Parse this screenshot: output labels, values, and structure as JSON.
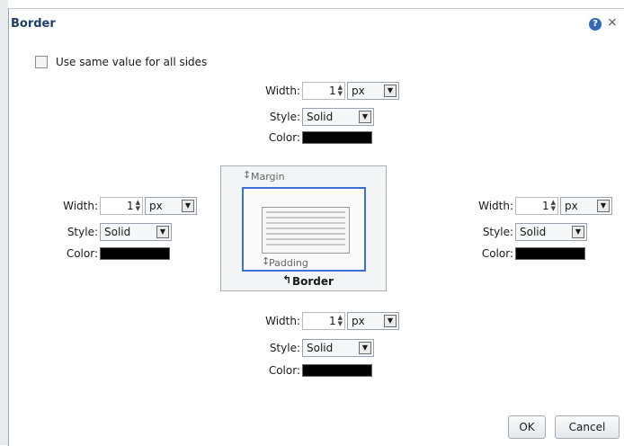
{
  "dialog": {
    "title": "Border",
    "help_icon": "?",
    "close_icon": "×"
  },
  "same_value": {
    "label": "Use same value for all sides",
    "checked": false
  },
  "labels": {
    "width": "Width:",
    "style": "Style:",
    "color": "Color:"
  },
  "top": {
    "width": "1",
    "unit": "px",
    "style": "Solid",
    "color": "#000000"
  },
  "left": {
    "width": "1",
    "unit": "px",
    "style": "Solid",
    "color": "#000000"
  },
  "right": {
    "width": "1",
    "unit": "px",
    "style": "Solid",
    "color": "#000000"
  },
  "bottom": {
    "width": "1",
    "unit": "px",
    "style": "Solid",
    "color": "#000000"
  },
  "diagram": {
    "margin": "Margin",
    "padding": "Padding",
    "border": "Border",
    "border_accent": "#3c6fd8"
  },
  "buttons": {
    "ok": "OK",
    "cancel": "Cancel"
  }
}
